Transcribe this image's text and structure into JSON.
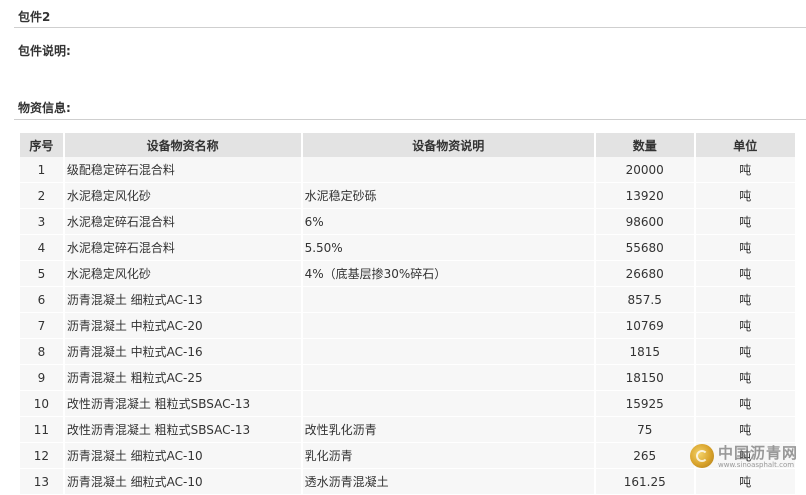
{
  "package": {
    "title": "包件2",
    "description_label": "包件说明:",
    "materials_label": "物资信息:"
  },
  "table": {
    "headers": [
      "序号",
      "设备物资名称",
      "设备物资说明",
      "数量",
      "单位"
    ],
    "rows": [
      {
        "no": "1",
        "name": "级配稳定碎石混合料",
        "desc": "",
        "qty": "20000",
        "unit": "吨"
      },
      {
        "no": "2",
        "name": "水泥稳定风化砂",
        "desc": "水泥稳定砂砾",
        "qty": "13920",
        "unit": "吨"
      },
      {
        "no": "3",
        "name": "水泥稳定碎石混合料",
        "desc": "6%",
        "qty": "98600",
        "unit": "吨"
      },
      {
        "no": "4",
        "name": "水泥稳定碎石混合料",
        "desc": "5.50%",
        "qty": "55680",
        "unit": "吨"
      },
      {
        "no": "5",
        "name": "水泥稳定风化砂",
        "desc": "4%（底基层掺30%碎石）",
        "qty": "26680",
        "unit": "吨"
      },
      {
        "no": "6",
        "name": "沥青混凝土 细粒式AC-13",
        "desc": "",
        "qty": "857.5",
        "unit": "吨"
      },
      {
        "no": "7",
        "name": "沥青混凝土 中粒式AC-20",
        "desc": "",
        "qty": "10769",
        "unit": "吨"
      },
      {
        "no": "8",
        "name": "沥青混凝土 中粒式AC-16",
        "desc": "",
        "qty": "1815",
        "unit": "吨"
      },
      {
        "no": "9",
        "name": "沥青混凝土 粗粒式AC-25",
        "desc": "",
        "qty": "18150",
        "unit": "吨"
      },
      {
        "no": "10",
        "name": "改性沥青混凝土 粗粒式SBSAC-13",
        "desc": "",
        "qty": "15925",
        "unit": "吨"
      },
      {
        "no": "11",
        "name": "改性沥青混凝土 粗粒式SBSAC-13",
        "desc": "改性乳化沥青",
        "qty": "75",
        "unit": "吨"
      },
      {
        "no": "12",
        "name": "沥青混凝土 细粒式AC-10",
        "desc": "乳化沥青",
        "qty": "265",
        "unit": "吨"
      },
      {
        "no": "13",
        "name": "沥青混凝土 细粒式AC-10",
        "desc": "透水沥青混凝土",
        "qty": "161.25",
        "unit": "吨"
      }
    ]
  },
  "watermark": {
    "text": "中国沥青网",
    "url": "www.sinoasphalt.com"
  }
}
